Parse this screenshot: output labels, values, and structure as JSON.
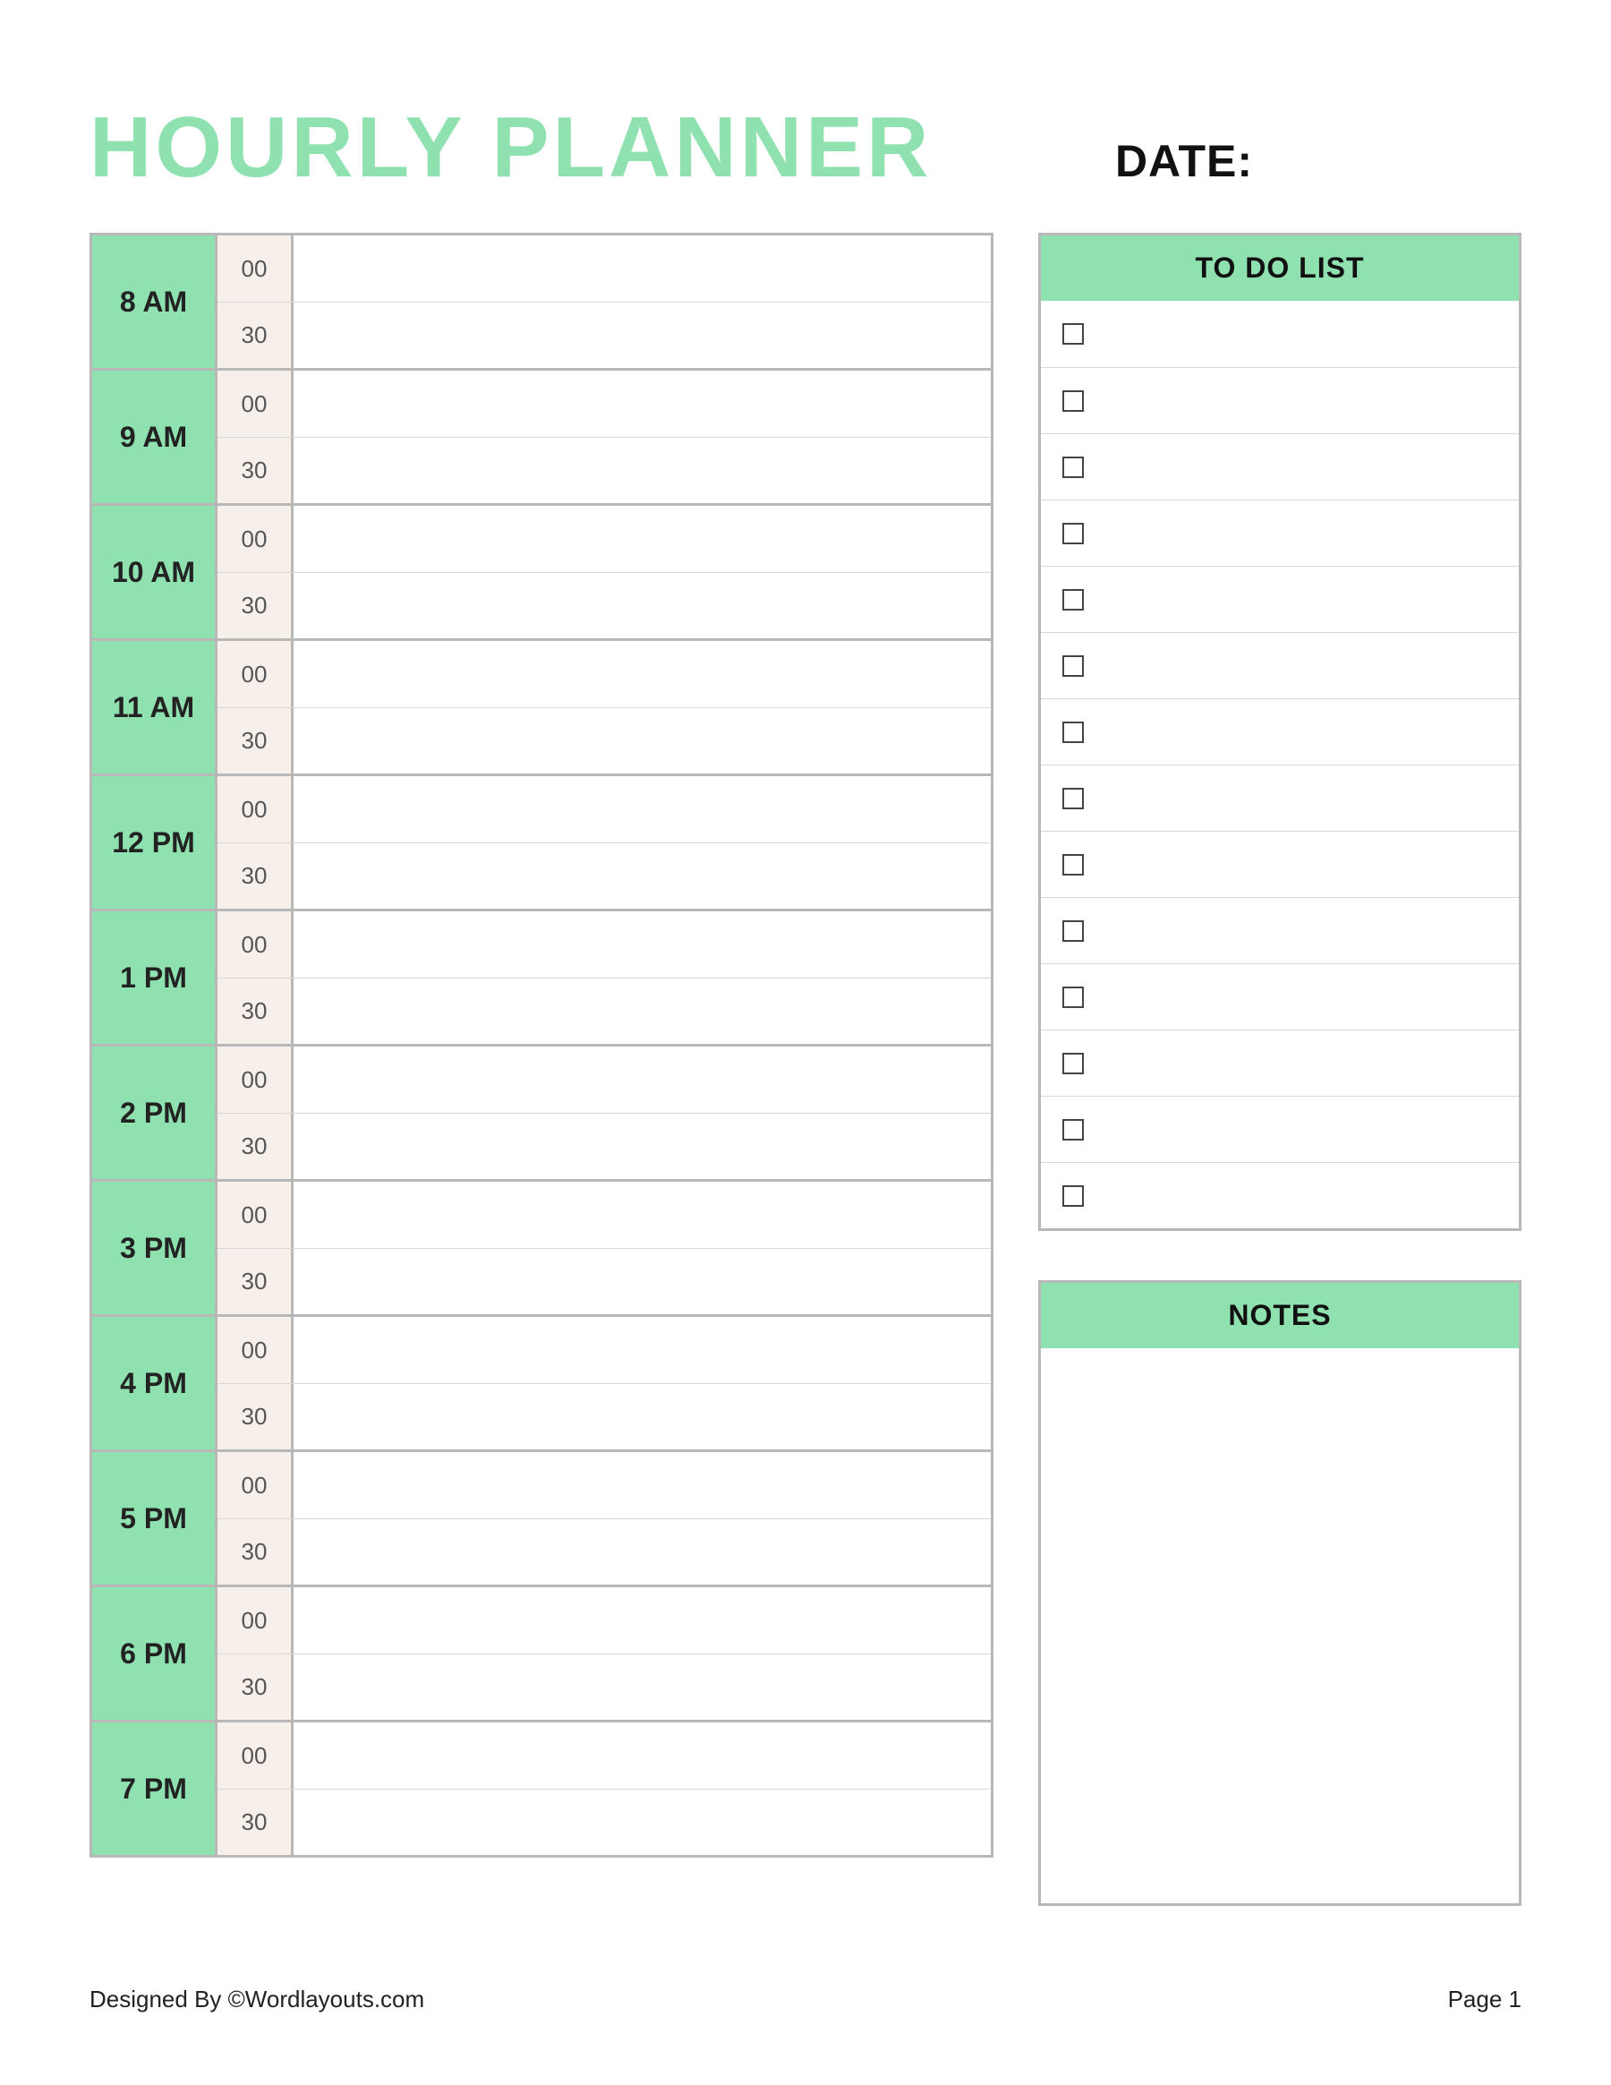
{
  "header": {
    "title": "HOURLY PLANNER",
    "date_label": "DATE:"
  },
  "schedule": {
    "hours": [
      {
        "label": "8 AM",
        "slots": [
          {
            "minute": "00",
            "text": ""
          },
          {
            "minute": "30",
            "text": ""
          }
        ]
      },
      {
        "label": "9 AM",
        "slots": [
          {
            "minute": "00",
            "text": ""
          },
          {
            "minute": "30",
            "text": ""
          }
        ]
      },
      {
        "label": "10 AM",
        "slots": [
          {
            "minute": "00",
            "text": ""
          },
          {
            "minute": "30",
            "text": ""
          }
        ]
      },
      {
        "label": "11 AM",
        "slots": [
          {
            "minute": "00",
            "text": ""
          },
          {
            "minute": "30",
            "text": ""
          }
        ]
      },
      {
        "label": "12 PM",
        "slots": [
          {
            "minute": "00",
            "text": ""
          },
          {
            "minute": "30",
            "text": ""
          }
        ]
      },
      {
        "label": "1 PM",
        "slots": [
          {
            "minute": "00",
            "text": ""
          },
          {
            "minute": "30",
            "text": ""
          }
        ]
      },
      {
        "label": "2 PM",
        "slots": [
          {
            "minute": "00",
            "text": ""
          },
          {
            "minute": "30",
            "text": ""
          }
        ]
      },
      {
        "label": "3 PM",
        "slots": [
          {
            "minute": "00",
            "text": ""
          },
          {
            "minute": "30",
            "text": ""
          }
        ]
      },
      {
        "label": "4 PM",
        "slots": [
          {
            "minute": "00",
            "text": ""
          },
          {
            "minute": "30",
            "text": ""
          }
        ]
      },
      {
        "label": "5 PM",
        "slots": [
          {
            "minute": "00",
            "text": ""
          },
          {
            "minute": "30",
            "text": ""
          }
        ]
      },
      {
        "label": "6 PM",
        "slots": [
          {
            "minute": "00",
            "text": ""
          },
          {
            "minute": "30",
            "text": ""
          }
        ]
      },
      {
        "label": "7 PM",
        "slots": [
          {
            "minute": "00",
            "text": ""
          },
          {
            "minute": "30",
            "text": ""
          }
        ]
      }
    ]
  },
  "todo": {
    "header": "TO DO LIST",
    "items": [
      {
        "checked": false,
        "text": ""
      },
      {
        "checked": false,
        "text": ""
      },
      {
        "checked": false,
        "text": ""
      },
      {
        "checked": false,
        "text": ""
      },
      {
        "checked": false,
        "text": ""
      },
      {
        "checked": false,
        "text": ""
      },
      {
        "checked": false,
        "text": ""
      },
      {
        "checked": false,
        "text": ""
      },
      {
        "checked": false,
        "text": ""
      },
      {
        "checked": false,
        "text": ""
      },
      {
        "checked": false,
        "text": ""
      },
      {
        "checked": false,
        "text": ""
      },
      {
        "checked": false,
        "text": ""
      },
      {
        "checked": false,
        "text": ""
      }
    ]
  },
  "notes": {
    "header": "NOTES",
    "text": ""
  },
  "footer": {
    "left": "Designed By ©Wordlayouts.com",
    "right": "Page 1"
  }
}
